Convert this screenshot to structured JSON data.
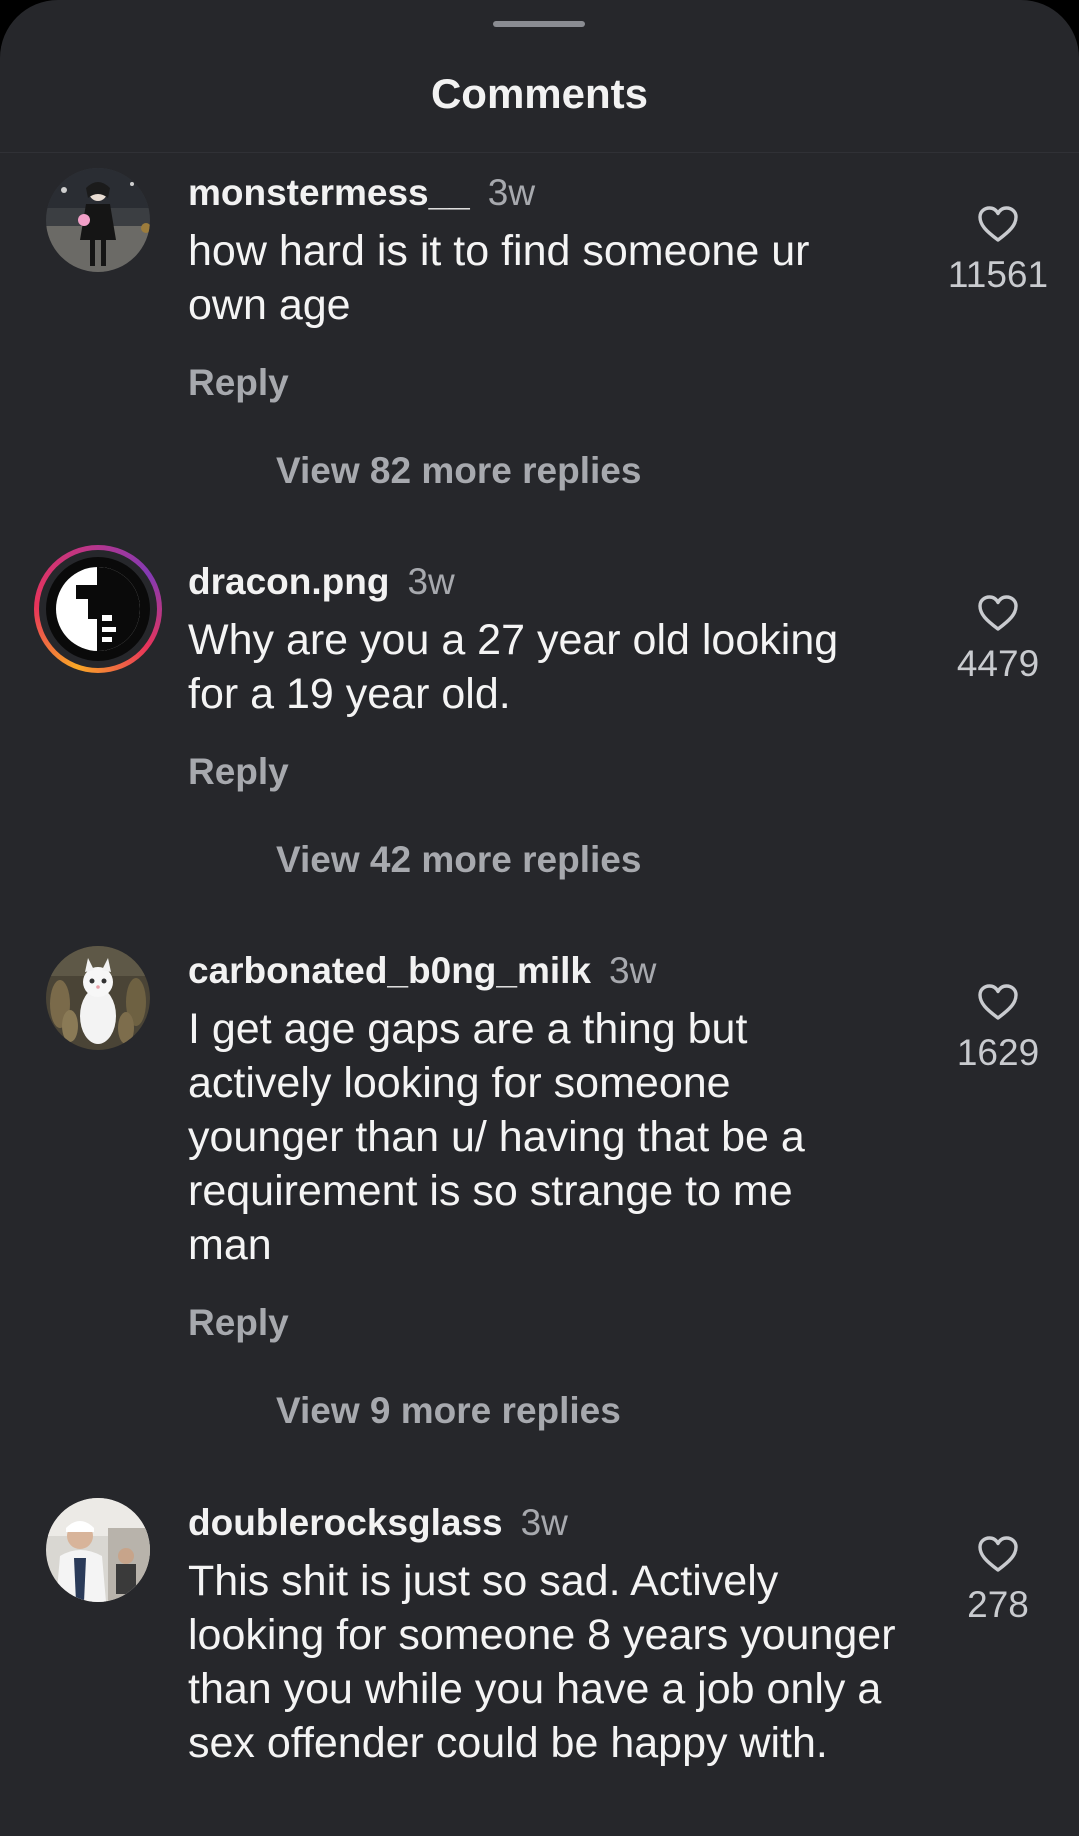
{
  "header": {
    "title": "Comments"
  },
  "icons": {
    "like": "heart-outline-icon",
    "avatar": "profile-avatar"
  },
  "colors": {
    "background": "#26272b",
    "primary_text": "#f2f2f2",
    "secondary_text": "#a7a9ae",
    "story_ring": [
      "#f9a826",
      "#e8345a",
      "#c13584",
      "#833ab4"
    ]
  },
  "comments": [
    {
      "username": "monstermess__",
      "time": "3w",
      "text": "how hard is it to find someone ur own age",
      "reply_label": "Reply",
      "view_replies": "View 82 more replies",
      "likes": "11561"
    },
    {
      "username": "dracon.png",
      "time": "3w",
      "text": "Why are you a 27 year old looking for a 19 year old.",
      "reply_label": "Reply",
      "view_replies": "View 42 more replies",
      "likes": "4479"
    },
    {
      "username": "carbonated_b0ng_milk",
      "time": "3w",
      "text": "I get age gaps are a thing but actively looking for someone younger than u/ having that be a requirement is so strange to me man",
      "reply_label": "Reply",
      "view_replies": "View 9 more replies",
      "likes": "1629"
    },
    {
      "username": "doublerocksglass",
      "time": "3w",
      "text": "This shit is just so sad. Actively looking for someone 8 years younger than you while you have a job only a sex offender could be happy with.",
      "likes": "278"
    }
  ]
}
